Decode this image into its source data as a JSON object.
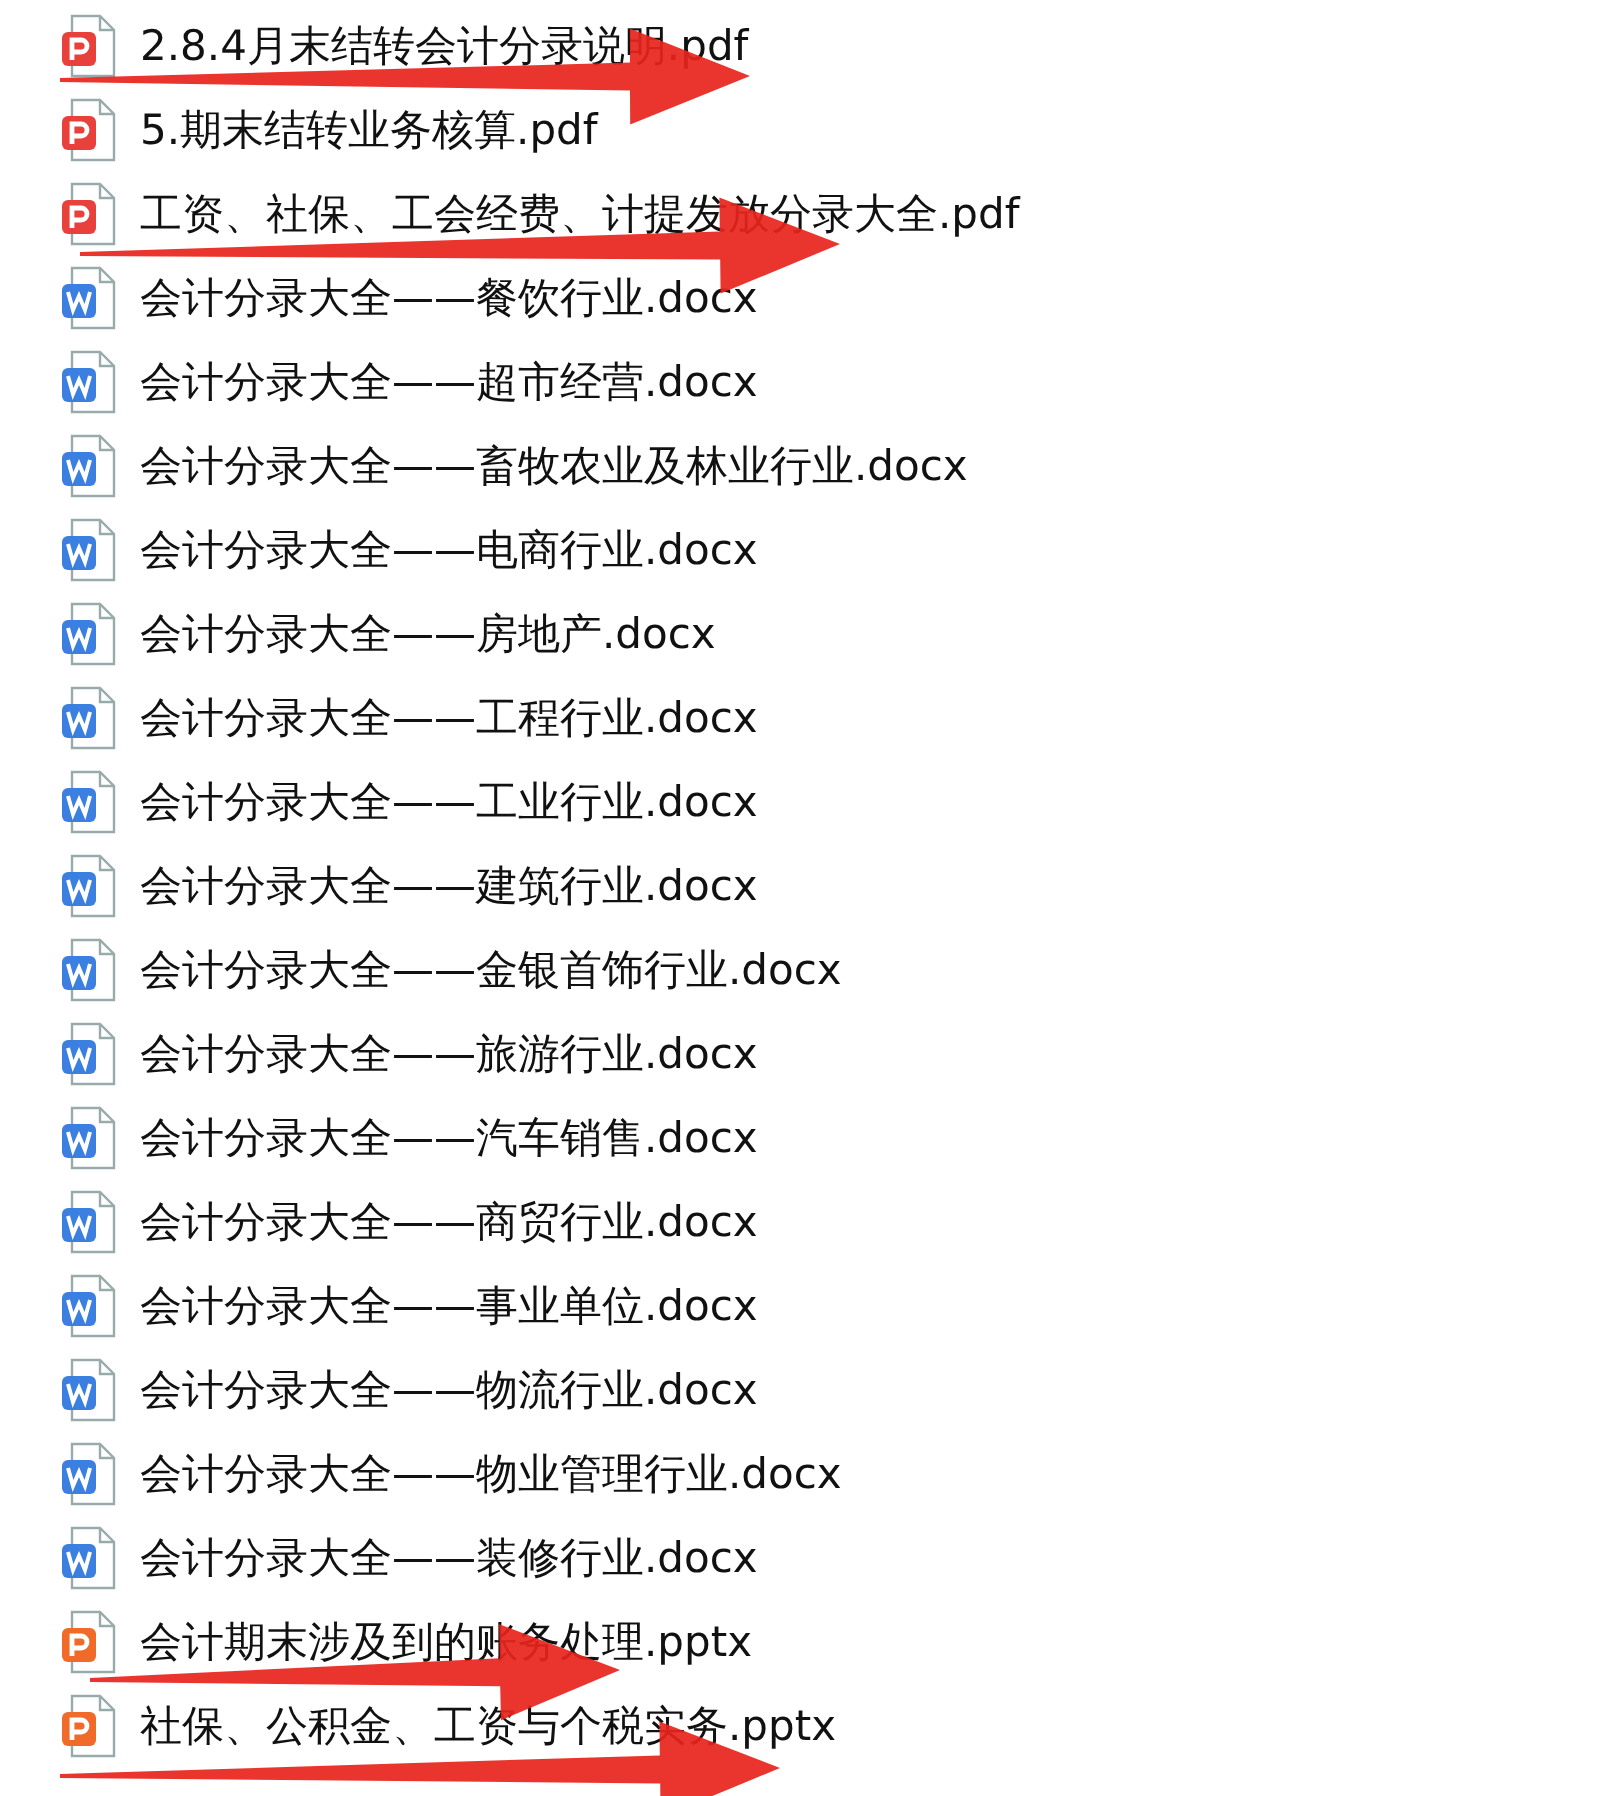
{
  "files": [
    {
      "name": "2.8.4月末结转会计分录说明.pdf",
      "kind": "pdf"
    },
    {
      "name": "5.期末结转业务核算.pdf",
      "kind": "pdf"
    },
    {
      "name": "工资、社保、工会经费、计提发放分录大全.pdf",
      "kind": "pdf"
    },
    {
      "name": "会计分录大全——餐饮行业.docx",
      "kind": "docx"
    },
    {
      "name": "会计分录大全——超市经营.docx",
      "kind": "docx"
    },
    {
      "name": "会计分录大全——畜牧农业及林业行业.docx",
      "kind": "docx"
    },
    {
      "name": "会计分录大全——电商行业.docx",
      "kind": "docx"
    },
    {
      "name": "会计分录大全——房地产.docx",
      "kind": "docx"
    },
    {
      "name": "会计分录大全——工程行业.docx",
      "kind": "docx"
    },
    {
      "name": "会计分录大全——工业行业.docx",
      "kind": "docx"
    },
    {
      "name": "会计分录大全——建筑行业.docx",
      "kind": "docx"
    },
    {
      "name": "会计分录大全——金银首饰行业.docx",
      "kind": "docx"
    },
    {
      "name": "会计分录大全——旅游行业.docx",
      "kind": "docx"
    },
    {
      "name": "会计分录大全——汽车销售.docx",
      "kind": "docx"
    },
    {
      "name": "会计分录大全——商贸行业.docx",
      "kind": "docx"
    },
    {
      "name": "会计分录大全——事业单位.docx",
      "kind": "docx"
    },
    {
      "name": "会计分录大全——物流行业.docx",
      "kind": "docx"
    },
    {
      "name": "会计分录大全——物业管理行业.docx",
      "kind": "docx"
    },
    {
      "name": "会计分录大全——装修行业.docx",
      "kind": "docx"
    },
    {
      "name": "会计期末涉及到的账务处理.pptx",
      "kind": "pptx"
    },
    {
      "name": "社保、公积金、工资与个税实务.pptx",
      "kind": "pptx"
    }
  ]
}
